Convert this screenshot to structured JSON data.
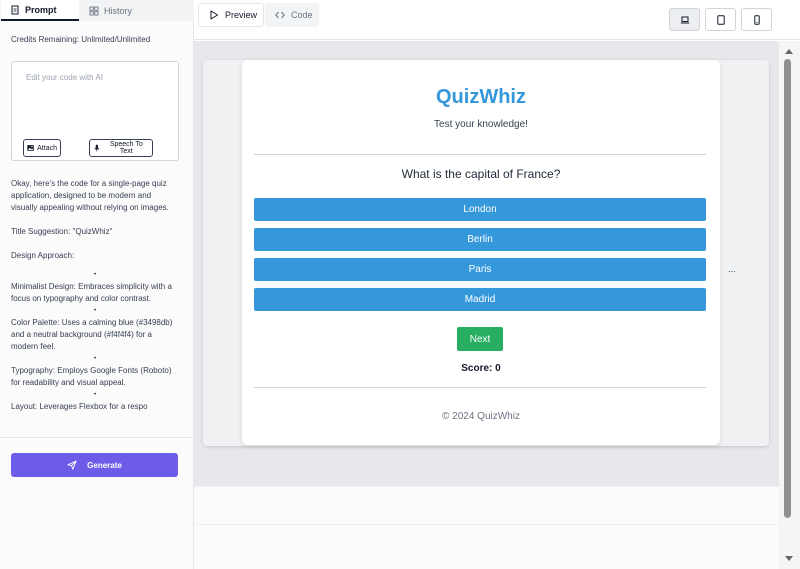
{
  "left_panel": {
    "tabs": [
      {
        "label": "Prompt"
      },
      {
        "label": "History"
      }
    ],
    "credits_text": "Credits Remaining: Unlimited/Unlimited",
    "editor": {
      "placeholder": "Edit your code with AI",
      "value": "",
      "attach_label": "Attach",
      "speech_label": "Speech To Text"
    },
    "chat": {
      "intro": "Okay, here's the code for a single-page quiz application, designed to be modern and visually appealing without relying on images.",
      "title_suggestion": "Title Suggestion: \"QuizWhiz\"",
      "design_approach": "Design Approach:",
      "bullet": "•",
      "items": [
        "Minimalist Design: Embraces simplicity with a focus on typography and color contrast.",
        "Color Palette: Uses a calming blue (#3498db) and a neutral background (#f4f4f4) for a modern feel.",
        "Typography: Employs Google Fonts (Roboto) for readability and visual appeal.",
        "Layout: Leverages Flexbox for a respo"
      ]
    },
    "generate_label": "Generate"
  },
  "toolbar": {
    "preview_label": "Preview",
    "code_label": "Code",
    "active_view": "Preview",
    "device_icons": [
      "laptop-icon",
      "tablet-icon",
      "phone-icon"
    ],
    "active_device": "laptop"
  },
  "quiz": {
    "title": "QuizWhiz",
    "subtitle": "Test your knowledge!",
    "question": "What is the capital of France?",
    "options": [
      "London",
      "Berlin",
      "Paris",
      "Madrid"
    ],
    "next_label": "Next",
    "score_text": "Score: 0",
    "footer": "© 2024 QuizWhiz",
    "overflow_indicator": "..."
  },
  "colors": {
    "accent_blue": "#3498db",
    "next_green": "#27ae60",
    "generate_purple": "#6c5ce7"
  }
}
